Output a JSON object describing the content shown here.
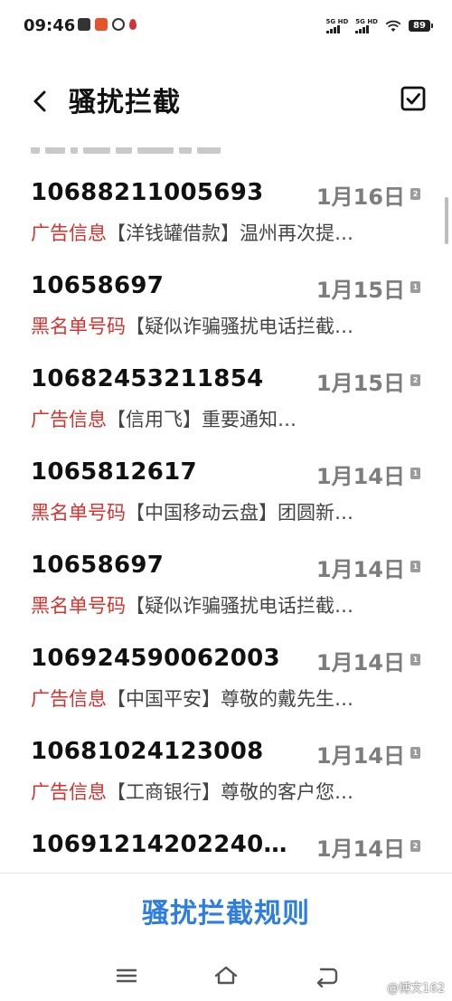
{
  "status_bar": {
    "time": "09:46",
    "signal1_label": "5G HD",
    "signal2_label": "5G HD",
    "battery": "89"
  },
  "header": {
    "title": "骚扰拦截"
  },
  "messages": [
    {
      "number": "10688211005693",
      "date": "1月16日",
      "sim": "2",
      "tag": "广告信息",
      "preview": "【洋钱罐借款】温州再次提…"
    },
    {
      "number": "10658697",
      "date": "1月15日",
      "sim": "1",
      "tag": "黑名单号码",
      "preview": "【疑似诈骗骚扰电话拦截…"
    },
    {
      "number": "10682453211854",
      "date": "1月15日",
      "sim": "2",
      "tag": "广告信息",
      "preview": "【信用飞】重要通知…"
    },
    {
      "number": "1065812617",
      "date": "1月14日",
      "sim": "1",
      "tag": "黑名单号码",
      "preview": "【中国移动云盘】团圆新…"
    },
    {
      "number": "10658697",
      "date": "1月14日",
      "sim": "1",
      "tag": "黑名单号码",
      "preview": "【疑似诈骗骚扰电话拦截…"
    },
    {
      "number": "106924590062003",
      "date": "1月14日",
      "sim": "1",
      "tag": "广告信息",
      "preview": "【中国平安】尊敬的戴先生…"
    },
    {
      "number": "10681024123008",
      "date": "1月14日",
      "sim": "1",
      "tag": "广告信息",
      "preview": "【工商银行】尊敬的客户您…"
    },
    {
      "number": "10691214202240…",
      "date": "1月14日",
      "sim": "2",
      "tag": "",
      "preview": ""
    }
  ],
  "footer": {
    "rules_label": "骚扰拦截规则"
  },
  "watermark": "@博文162",
  "colors": {
    "tag_red": "#d8322f",
    "link_blue": "#2d7ee0",
    "date_gray": "#7d7d7d"
  }
}
